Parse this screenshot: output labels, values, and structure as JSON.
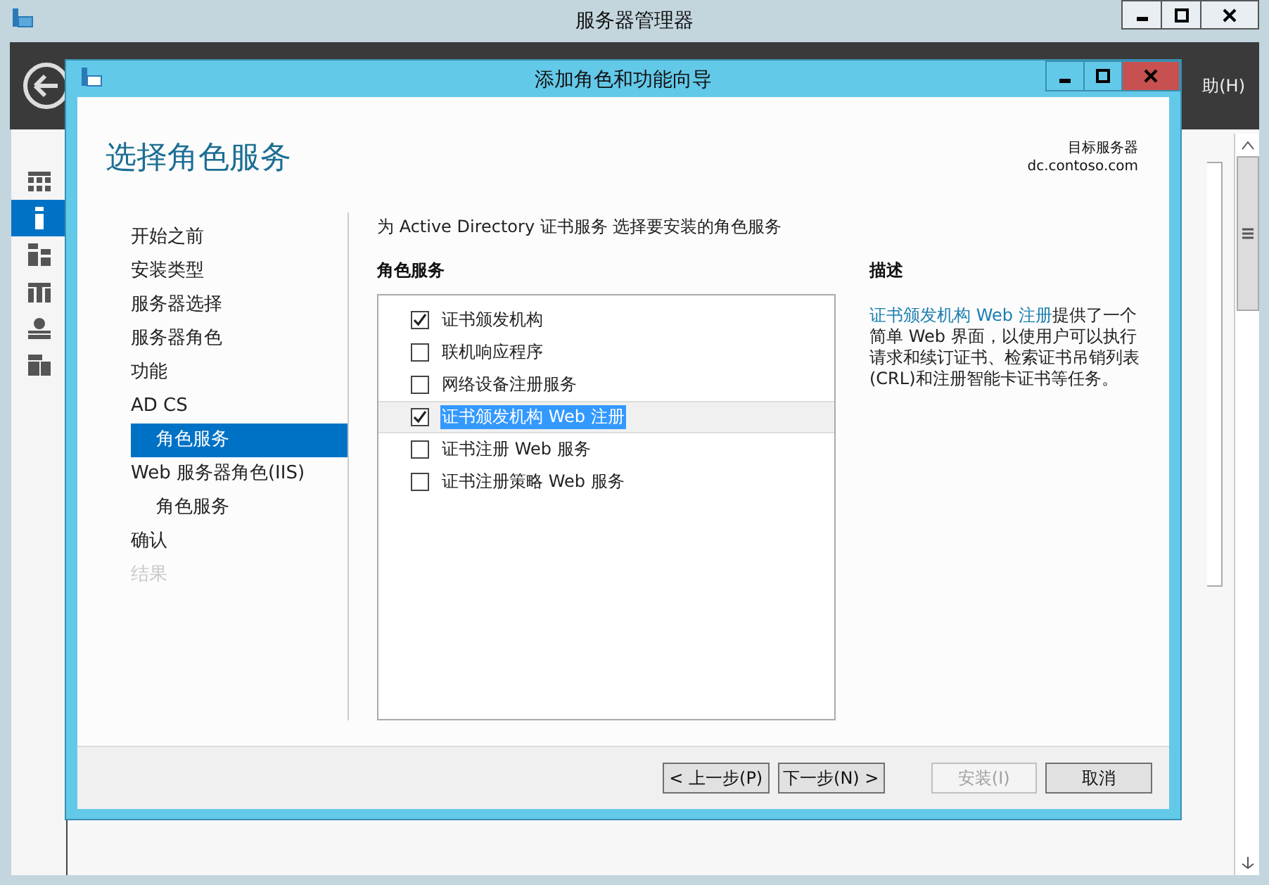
{
  "background_window": {
    "title": "服务器管理器",
    "menu_partial": "助(H)",
    "nav_icons": [
      {
        "selected": false
      },
      {
        "selected": true
      },
      {
        "selected": false
      },
      {
        "selected": false
      },
      {
        "selected": false
      },
      {
        "selected": false
      }
    ]
  },
  "dialog": {
    "title": "添加角色和功能向导",
    "heading": "选择角色服务",
    "target_server_label": "目标服务器",
    "target_server": "dc.contoso.com",
    "steps": [
      {
        "label": "开始之前",
        "selected": false,
        "disabled": false
      },
      {
        "label": "安装类型",
        "selected": false,
        "disabled": false
      },
      {
        "label": "服务器选择",
        "selected": false,
        "disabled": false
      },
      {
        "label": "服务器角色",
        "selected": false,
        "disabled": false
      },
      {
        "label": "功能",
        "selected": false,
        "disabled": false
      },
      {
        "label": "AD CS",
        "selected": false,
        "disabled": false,
        "children": [
          {
            "label": "角色服务",
            "selected": true,
            "disabled": false
          }
        ]
      },
      {
        "label": "Web 服务器角色(IIS)",
        "selected": false,
        "disabled": false,
        "children": [
          {
            "label": "角色服务",
            "selected": false,
            "disabled": false
          }
        ]
      },
      {
        "label": "确认",
        "selected": false,
        "disabled": false
      },
      {
        "label": "结果",
        "selected": false,
        "disabled": true
      }
    ],
    "intro": "为 Active Directory 证书服务 选择要安装的角色服务",
    "list_heading": "角色服务",
    "role_services": [
      {
        "label": "证书颁发机构",
        "checked": true,
        "selected": false
      },
      {
        "label": "联机响应程序",
        "checked": false,
        "selected": false
      },
      {
        "label": "网络设备注册服务",
        "checked": false,
        "selected": false
      },
      {
        "label": "证书颁发机构 Web 注册",
        "checked": true,
        "selected": true
      },
      {
        "label": "证书注册 Web 服务",
        "checked": false,
        "selected": false
      },
      {
        "label": "证书注册策略 Web 服务",
        "checked": false,
        "selected": false
      }
    ],
    "description_heading": "描述",
    "description": {
      "link": "证书颁发机构 Web 注册",
      "text": "提供了一个简单 Web 界面，以使用户可以执行请求和续订证书、检索证书吊销列表(CRL)和注册智能卡证书等任务。"
    },
    "buttons": [
      {
        "label": "< 上一步(P)",
        "disabled": false
      },
      {
        "label": "下一步(N) >",
        "disabled": false
      },
      {
        "label": "安装(I)",
        "disabled": true
      },
      {
        "label": "取消",
        "disabled": false
      }
    ]
  }
}
